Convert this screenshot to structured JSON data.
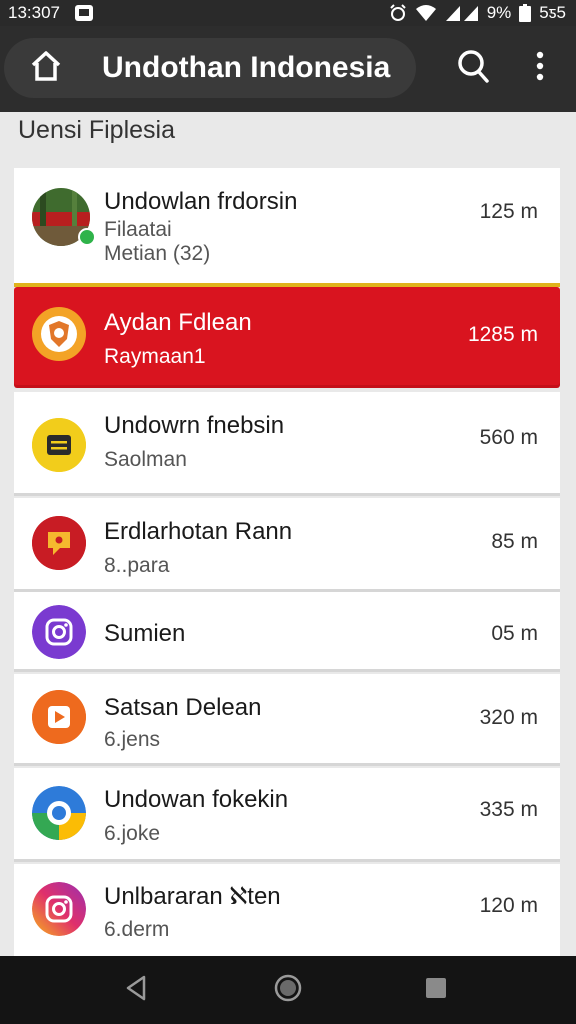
{
  "status_bar": {
    "time": "13:307",
    "battery_percent": "9%",
    "right_text": "5ƽ5",
    "icons": [
      "notification-icon",
      "alarm-icon",
      "wifi-icon",
      "signal-icon",
      "battery-icon"
    ]
  },
  "app_bar": {
    "title": "Undothan Indonesia",
    "icons": [
      "home-icon",
      "search-icon",
      "more-vert-icon"
    ]
  },
  "section": {
    "title": "Uensi Fiplesia"
  },
  "list": [
    {
      "title": "Undowlan frdorsin",
      "line2": "Filaatai",
      "line3": "Metian (32)",
      "distance": "125 m",
      "icon": "landscape-avatar-icon",
      "online": true,
      "highlighted": false
    },
    {
      "title": "Aydan Fdlean",
      "line2": "Raymaan1",
      "distance": "1285 m",
      "icon": "shield-badge-icon",
      "highlighted": true,
      "accent_color": "#d9141f"
    },
    {
      "title": "Undowrn fnebsin",
      "line2": "Saolman",
      "distance": "560 m",
      "icon": "note-icon",
      "highlighted": false
    },
    {
      "title": "Erdlarhotan Rann",
      "line2": "8..para",
      "distance": "85 m",
      "icon": "chat-bubble-icon",
      "highlighted": false
    },
    {
      "title": "Sumien",
      "distance": "05 m",
      "icon": "camera-icon",
      "highlighted": false
    },
    {
      "title": "Satsan Delean",
      "line2": "6.jens",
      "distance": "320 m",
      "icon": "play-icon",
      "highlighted": false
    },
    {
      "title": "Undowan fokekin",
      "line2": "6.joke",
      "distance": "335 m",
      "icon": "globe-icon",
      "highlighted": false
    },
    {
      "title": "Unlbararan ℵten",
      "line2": "6.derm",
      "distance": "120 m",
      "icon": "camera-icon",
      "highlighted": false
    }
  ],
  "nav_bar": {
    "icons": [
      "back-icon",
      "home-circle-icon",
      "recents-icon"
    ]
  }
}
